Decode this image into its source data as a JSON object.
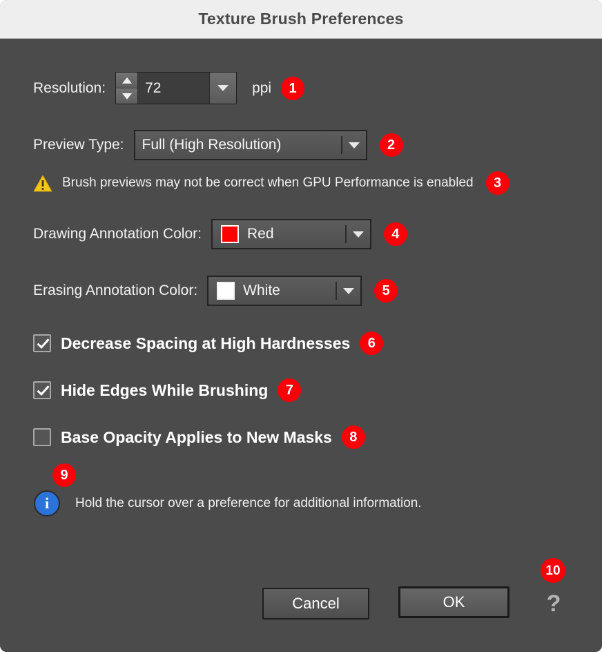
{
  "window": {
    "title": "Texture Brush Preferences"
  },
  "colors": {
    "badge": "#FB0007",
    "titlebar_bg": "#EFEEEE",
    "content_bg": "#4B4B4B",
    "drawing_swatch": "#FF0000",
    "erasing_swatch": "#FFFFFF",
    "info_blue": "#2B73D8",
    "warning_yellow": "#F5C518"
  },
  "resolution": {
    "label": "Resolution:",
    "value": "72",
    "unit": "ppi",
    "badge": "1",
    "stepper_up_icon": "triangle-up-icon",
    "stepper_down_icon": "triangle-down-icon",
    "dropdown_icon": "chevron-down-icon"
  },
  "preview_type": {
    "label": "Preview Type:",
    "value": "Full (High Resolution)",
    "badge": "2",
    "dropdown_icon": "chevron-down-icon"
  },
  "warning": {
    "icon": "warning-triangle-icon",
    "text": "Brush previews may not be correct when GPU Performance is enabled",
    "badge": "3"
  },
  "drawing_color": {
    "label": "Drawing Annotation Color:",
    "value": "Red",
    "swatch": "#FF0000",
    "badge": "4",
    "dropdown_icon": "chevron-down-icon"
  },
  "erasing_color": {
    "label": "Erasing Annotation Color:",
    "value": "White",
    "swatch": "#FFFFFF",
    "badge": "5",
    "dropdown_icon": "chevron-down-icon"
  },
  "checkboxes": [
    {
      "label": "Decrease Spacing at High Hardnesses",
      "checked": true,
      "badge": "6"
    },
    {
      "label": "Hide Edges While Brushing",
      "checked": true,
      "badge": "7"
    },
    {
      "label": "Base Opacity Applies to New Masks",
      "checked": false,
      "badge": "8"
    }
  ],
  "info": {
    "icon": "info-circle-icon",
    "glyph": "i",
    "text": "Hold the cursor over a preference for additional information.",
    "badge": "9"
  },
  "footer": {
    "cancel_label": "Cancel",
    "ok_label": "OK",
    "help_glyph": "?",
    "help_badge": "10"
  }
}
